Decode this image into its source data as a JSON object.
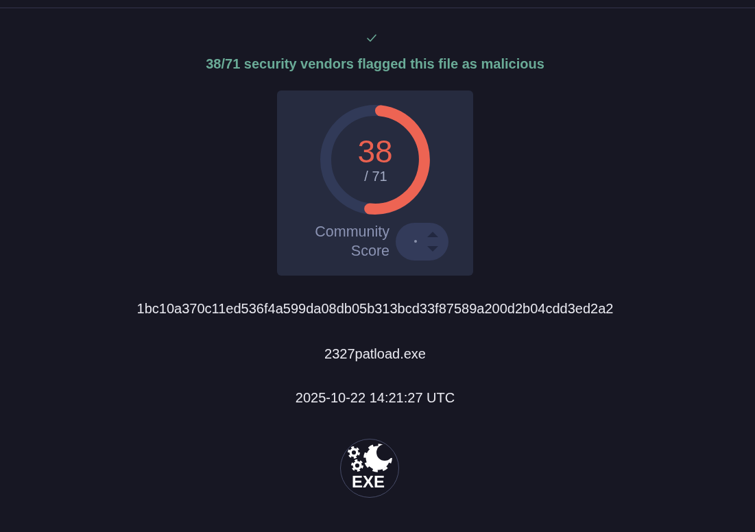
{
  "verdict": {
    "summary": "38/71 security vendors flagged this file as malicious"
  },
  "detection_score": {
    "detections": "38",
    "total": "/ 71",
    "level": 0.535
  },
  "community_score": {
    "label": "Community Score"
  },
  "file": {
    "sha256": "1bc10a370c11ed536f4a599da08db05b313bcd33f87589a200d2b04cdd3ed2a2",
    "name": "2327patload.exe",
    "date": "2025-10-22 14:21:27 UTC",
    "type_label": "EXE"
  }
}
